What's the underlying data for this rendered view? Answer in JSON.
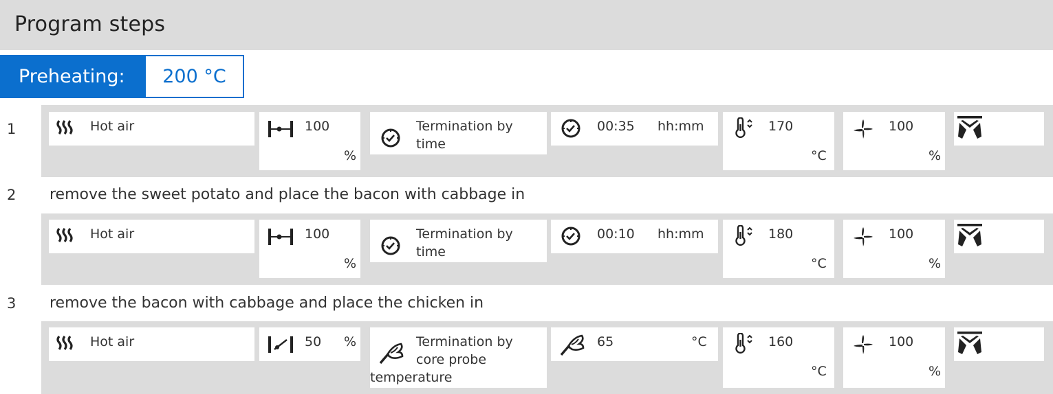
{
  "header": {
    "title": "Program steps"
  },
  "preheating": {
    "label": "Preheating:",
    "value": "200 °C"
  },
  "steps": [
    {
      "number": "1",
      "note": "",
      "mode": "Hot air",
      "humidity": {
        "value": "100",
        "unit": "%"
      },
      "termination": {
        "line1": "Termination by",
        "line2": "time",
        "line3": ""
      },
      "target": {
        "value": "00:35",
        "unit": "hh:mm",
        "icon": "clock-icon"
      },
      "temperature": {
        "value": "170",
        "unit": "°C"
      },
      "fan": {
        "value": "100",
        "unit": "%"
      }
    },
    {
      "number": "2",
      "note": "remove the sweet potato and place the bacon with cabbage in",
      "mode": "Hot air",
      "humidity": {
        "value": "100",
        "unit": "%"
      },
      "termination": {
        "line1": "Termination by",
        "line2": "time",
        "line3": ""
      },
      "target": {
        "value": "00:10",
        "unit": "hh:mm",
        "icon": "clock-icon"
      },
      "temperature": {
        "value": "180",
        "unit": "°C"
      },
      "fan": {
        "value": "100",
        "unit": "%"
      }
    },
    {
      "number": "3",
      "note": "remove the bacon with cabbage and place the chicken in",
      "mode": "Hot air",
      "humidity": {
        "value": "50",
        "unit": "%"
      },
      "termination": {
        "line1": "Termination by",
        "line2": "core probe",
        "line3": "temperature"
      },
      "target": {
        "value": "65",
        "unit": "°C",
        "icon": "core-probe-icon"
      },
      "temperature": {
        "value": "160",
        "unit": "°C"
      },
      "fan": {
        "value": "100",
        "unit": "%"
      }
    }
  ],
  "icons": [
    "hot-air-icon",
    "humidity-icon",
    "clock-icon",
    "core-probe-icon",
    "thermometer-icon",
    "fan-icon",
    "fan-stop-icon"
  ],
  "colors": {
    "accent": "#0b6fce",
    "band": "#dcdcdc"
  }
}
